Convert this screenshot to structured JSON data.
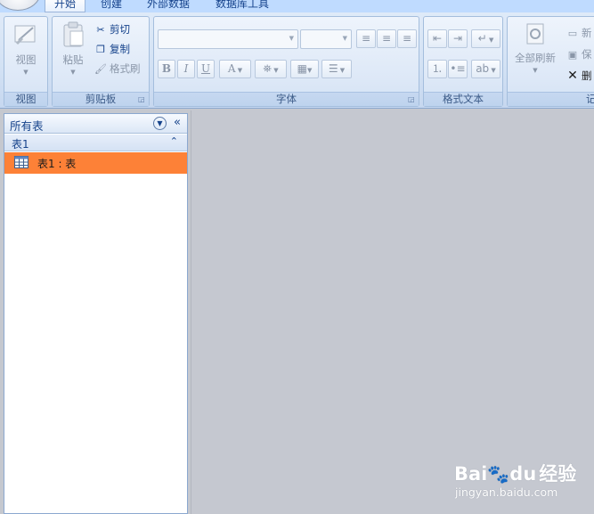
{
  "tabs": [
    {
      "label": "开始",
      "active": true
    },
    {
      "label": "创建",
      "active": false
    },
    {
      "label": "外部数据",
      "active": false
    },
    {
      "label": "数据库工具",
      "active": false
    }
  ],
  "ribbon": {
    "view_group": {
      "label": "视图",
      "view_button": "视图"
    },
    "clipboard_group": {
      "label": "剪贴板",
      "paste": "粘贴",
      "cut": "剪切",
      "copy": "复制",
      "format_painter": "格式刷"
    },
    "font_group": {
      "label": "字体",
      "bold": "B",
      "italic": "I",
      "underline": "U",
      "font_color": "A"
    },
    "rich_text_group": {
      "label": "格式文本"
    },
    "records_group": {
      "label": "记",
      "refresh_all": "全部刷新",
      "new": "新",
      "save": "保",
      "delete": "删"
    }
  },
  "nav": {
    "title": "所有表",
    "collapse_glyph": "«",
    "group": {
      "label": "表1",
      "toggle": "⌃"
    },
    "items": [
      {
        "label": "表1 : 表"
      }
    ]
  },
  "watermark": {
    "brand": "Bai",
    "brand2": "du",
    "suffix": "经验",
    "url": "jingyan.baidu.com"
  },
  "colors": {
    "accent_selected": "#fd8137",
    "ribbon": "#d2e1f4",
    "workspace": "#c5c8d0"
  }
}
